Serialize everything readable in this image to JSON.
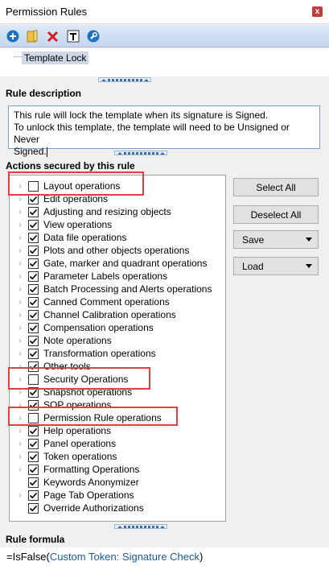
{
  "window": {
    "title": "Permission Rules",
    "close_label": "x"
  },
  "toolbar": {
    "buttons": [
      {
        "name": "add-rule-button",
        "icon": "plus-circle-icon"
      },
      {
        "name": "open-folder-button",
        "icon": "folder-icon"
      },
      {
        "name": "delete-button",
        "icon": "red-x-icon"
      },
      {
        "name": "rename-button",
        "icon": "text-t-icon"
      },
      {
        "name": "settings-button",
        "icon": "wrench-icon"
      }
    ]
  },
  "tree": {
    "selected_node": "Template Lock"
  },
  "rule_description": {
    "heading": "Rule description",
    "line1": "This rule will lock the template when its signature is Signed.",
    "line2": "To unlock this template, the template will need to be Unsigned or Never",
    "line3": "Signed."
  },
  "actions": {
    "heading": "Actions secured by this rule",
    "items": [
      {
        "label": "Layout operations",
        "checked": false,
        "expandable": true
      },
      {
        "label": "Edit operations",
        "checked": true,
        "expandable": true
      },
      {
        "label": "Adjusting and resizing objects",
        "checked": true,
        "expandable": true
      },
      {
        "label": "View operations",
        "checked": true,
        "expandable": true
      },
      {
        "label": "Data file operations",
        "checked": true,
        "expandable": true
      },
      {
        "label": "Plots and other objects operations",
        "checked": true,
        "expandable": true
      },
      {
        "label": "Gate, marker and quadrant operations",
        "checked": true,
        "expandable": true
      },
      {
        "label": "Parameter Labels operations",
        "checked": true,
        "expandable": true
      },
      {
        "label": "Batch Processing and Alerts operations",
        "checked": true,
        "expandable": true
      },
      {
        "label": "Canned Comment operations",
        "checked": true,
        "expandable": true
      },
      {
        "label": "Channel Calibration operations",
        "checked": true,
        "expandable": true
      },
      {
        "label": "Compensation operations",
        "checked": true,
        "expandable": true
      },
      {
        "label": "Note operations",
        "checked": true,
        "expandable": true
      },
      {
        "label": "Transformation operations",
        "checked": true,
        "expandable": true
      },
      {
        "label": "Other tools",
        "checked": true,
        "expandable": true
      },
      {
        "label": "Security Operations",
        "checked": false,
        "expandable": true
      },
      {
        "label": "Snapshot operations",
        "checked": true,
        "expandable": true
      },
      {
        "label": "SOP operations",
        "checked": true,
        "expandable": true
      },
      {
        "label": "Permission Rule operations",
        "checked": false,
        "expandable": true
      },
      {
        "label": "Help operations",
        "checked": true,
        "expandable": true
      },
      {
        "label": "Panel operations",
        "checked": true,
        "expandable": true
      },
      {
        "label": "Token operations",
        "checked": true,
        "expandable": true
      },
      {
        "label": "Formatting Operations",
        "checked": true,
        "expandable": true
      },
      {
        "label": "Keywords Anonymizer",
        "checked": true,
        "expandable": false
      },
      {
        "label": "Page Tab Operations",
        "checked": true,
        "expandable": true
      },
      {
        "label": "Override Authorizations",
        "checked": true,
        "expandable": false
      }
    ]
  },
  "buttons": {
    "select_all": "Select All",
    "deselect_all": "Deselect All",
    "save": "Save",
    "load": "Load"
  },
  "rule_formula": {
    "heading": "Rule formula",
    "prefix": "=IsFalse(",
    "token": "Custom Token: Signature Check",
    "suffix": ")"
  },
  "colors": {
    "highlight": "#e04040",
    "toolbar": "#c5d7ef",
    "accent": "#3a6ea5"
  }
}
